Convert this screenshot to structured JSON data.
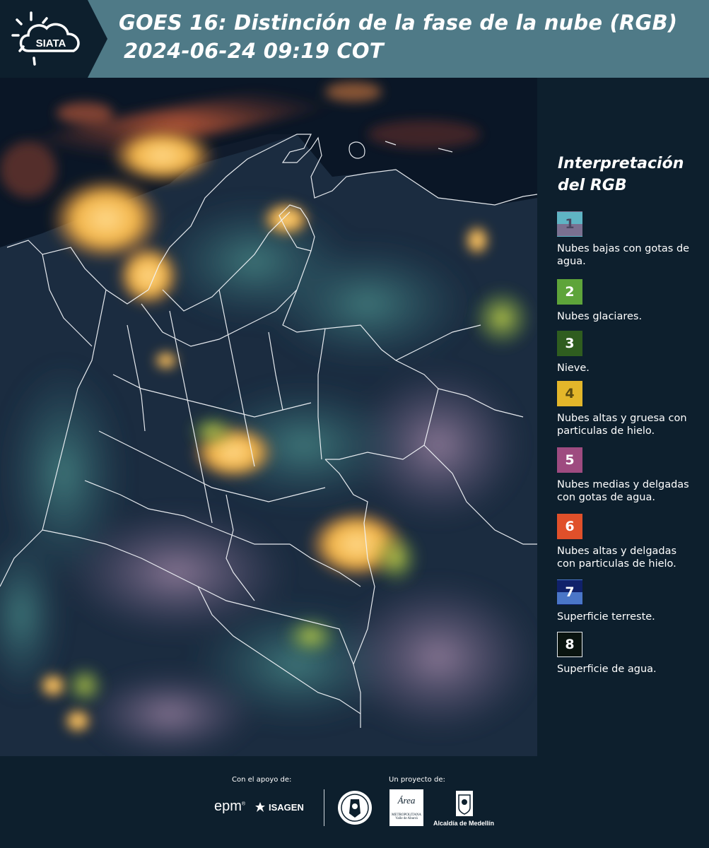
{
  "header": {
    "title_line1": "GOES 16: Distinción de la fase de la nube (RGB)",
    "title_line2": "2024-06-24 09:19 COT",
    "logo_text": "SIATA"
  },
  "legend": {
    "title": "Interpretación del RGB",
    "items": [
      {
        "number": "1",
        "label": "Nubes bajas con gotas de agua.",
        "color_top": "#5fb4c4",
        "color_bottom": "#7a7090"
      },
      {
        "number": "2",
        "label": "Nubes glaciares.",
        "color_top": "#5ea43a",
        "color_bottom": "#5ea43a"
      },
      {
        "number": "3",
        "label": "Nieve.",
        "color_top": "#2f5d1f",
        "color_bottom": "#2f5d1f"
      },
      {
        "number": "4",
        "label": "Nubes altas y gruesa con particulas de hielo.",
        "color_top": "#e3b62a",
        "color_bottom": "#e3b62a"
      },
      {
        "number": "5",
        "label": "Nubes medias y delgadas con gotas de agua.",
        "color_top": "#9e4b80",
        "color_bottom": "#9e4b80"
      },
      {
        "number": "6",
        "label": "Nubes altas y delgadas con particulas de hielo.",
        "color_top": "#e0502a",
        "color_bottom": "#e0502a"
      },
      {
        "number": "7",
        "label": "Superficie terreste.",
        "color_top": "#10216a",
        "color_bottom": "#4a76c8"
      },
      {
        "number": "8",
        "label": "Superficie de agua.",
        "color_top": "#0a1410",
        "color_bottom": "#0a1410"
      }
    ]
  },
  "footer": {
    "support_label": "Con el apoyo de:",
    "project_label": "Un proyecto de:",
    "sponsor1": "epm",
    "sponsor2": "ISAGEN",
    "partner1_top": "Área",
    "partner1_sub1": "METROPOLITANA",
    "partner1_sub2": "Valle de Aburrá",
    "partner2": "Alcaldía de Medellín"
  },
  "map": {
    "description_icon": "satellite-rgb-map"
  }
}
